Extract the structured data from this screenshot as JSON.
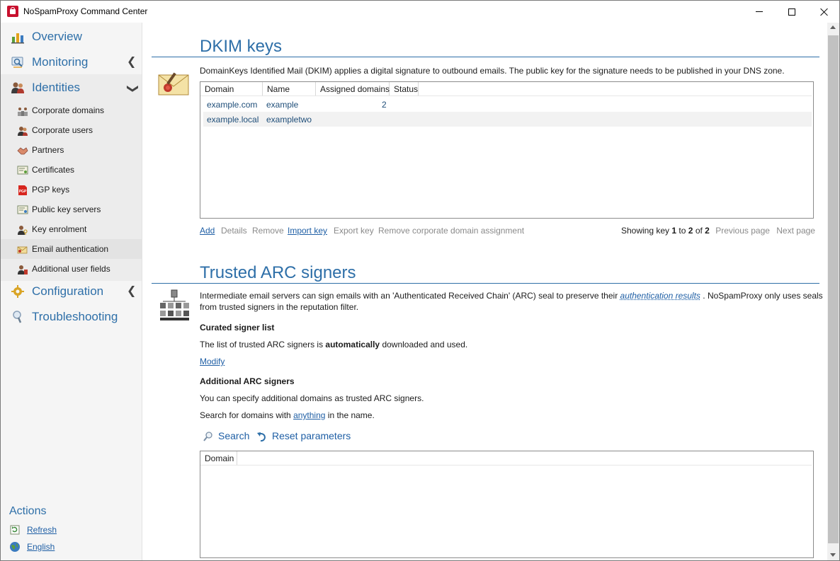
{
  "window": {
    "title": "NoSpamProxy Command Center"
  },
  "sidebar": {
    "top_items": [
      {
        "label": "Overview"
      },
      {
        "label": "Monitoring"
      },
      {
        "label": "Identities"
      },
      {
        "label": "Configuration"
      },
      {
        "label": "Troubleshooting"
      }
    ],
    "identities_items": [
      {
        "label": "Corporate domains"
      },
      {
        "label": "Corporate users"
      },
      {
        "label": "Partners"
      },
      {
        "label": "Certificates"
      },
      {
        "label": "PGP keys"
      },
      {
        "label": "Public key servers"
      },
      {
        "label": "Key enrolment"
      },
      {
        "label": "Email authentication",
        "selected": true
      },
      {
        "label": "Additional user fields"
      }
    ],
    "actions_title": "Actions",
    "actions": [
      {
        "label": "Refresh"
      },
      {
        "label": "English"
      }
    ]
  },
  "dkim": {
    "title": "DKIM keys",
    "description": "DomainKeys Identified Mail (DKIM) applies a digital signature to outbound emails. The public key for the signature needs to be published in your DNS zone.",
    "columns": [
      "Domain",
      "Name",
      "Assigned domains",
      "Status"
    ],
    "rows": [
      {
        "domain": "example.com",
        "name": "example",
        "assigned": "2",
        "status": ""
      },
      {
        "domain": "example.local",
        "name": "exampletwo",
        "assigned": "",
        "status": ""
      }
    ],
    "toolbar": {
      "add": "Add",
      "details": "Details",
      "remove": "Remove",
      "import": "Import key",
      "export": "Export key",
      "remove_assignment": "Remove corporate domain assignment"
    },
    "pager": {
      "prefix": "Showing key",
      "from": "1",
      "to_word": "to",
      "to": "2",
      "of_word": "of",
      "total": "2",
      "previous": "Previous page",
      "next": "Next page"
    }
  },
  "arc": {
    "title": "Trusted ARC signers",
    "description_part1": "Intermediate email servers can sign emails with an 'Authenticated Received Chain' (ARC) seal to preserve their ",
    "description_link": "authentication results",
    "description_part2": " . NoSpamProxy only uses seals",
    "description_line2": "from trusted signers in the reputation filter.",
    "curated_heading": "Curated signer list",
    "curated_text_pre": "The list of trusted ARC signers is ",
    "curated_text_bold": "automatically",
    "curated_text_post": " downloaded and used.",
    "modify": "Modify",
    "additional_heading": "Additional ARC signers",
    "additional_text": "You can specify additional domains as trusted ARC signers.",
    "search_text_pre": "Search for domains with ",
    "search_text_link": "anything",
    "search_text_post": " in the name.",
    "search_button": "Search",
    "reset_button": "Reset parameters",
    "columns": [
      "Domain"
    ]
  },
  "colors": {
    "accent": "#2e6fa8",
    "link": "#1f5fa5",
    "disabled": "#8a8a8a"
  }
}
